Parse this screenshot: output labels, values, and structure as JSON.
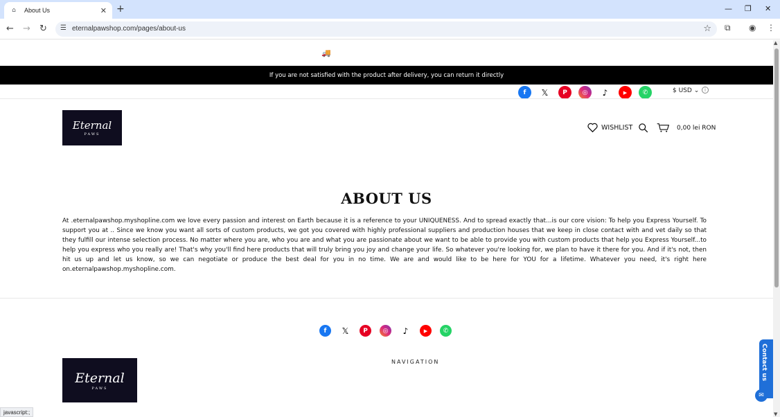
{
  "browser": {
    "tab_title": "About Us",
    "new_tab": "+",
    "url": "eternalpawshop.com/pages/about-us",
    "status_text": "javascript:;"
  },
  "top": {
    "shipping_icon": "🚚",
    "announcement": "If you are not satisfied with the product after delivery, you can return it directly",
    "currency": "$ USD",
    "currency_chevron": "⌄",
    "social_icons": [
      "facebook-icon",
      "x-icon",
      "pinterest-icon",
      "instagram-icon",
      "tiktok-icon",
      "youtube-icon",
      "whatsapp-icon"
    ]
  },
  "logo": {
    "script": "Eternal",
    "sub": "PAWS"
  },
  "header": {
    "wishlist_label": "WISHLIST",
    "cart_total": "0,00 lei RON"
  },
  "main": {
    "title": "ABOUT US",
    "body": "At .eternalpawshop.myshopline.com we love every passion and interest on Earth because it is a reference to your UNIQUENESS. And to spread exactly that...is our core vision: To help you Express Yourself. To support you at .. Since we know you want all sorts of custom products, we got you covered with highly professional suppliers and production houses that we keep in close contact with and vet daily so that they fulfill our intense selection process. No matter where you are, who you are and what you are passionate about we want to be able to provide you with custom products that help you Express Yourself...to help you express who you really are! That's why you'll find here products that will truly bring you joy and change your life. So whatever you're looking for, we plan to have it there for you. And if it's not, then hit us up and let us know, so we can negotiate or produce the best deal for you in no time. We are and would like to be here for YOU for a lifetime. Whatever you need, it's right here on.eternalpawshop.myshopline.com."
  },
  "footer": {
    "navigation_heading": "NAVIGATION",
    "contact_label": "Contact us"
  }
}
